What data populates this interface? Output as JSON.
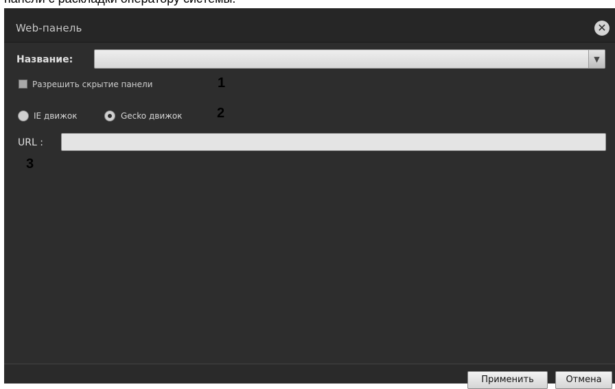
{
  "page": {
    "caption": "панели с раскладки оператору системы."
  },
  "dialog": {
    "title": "Web-панель",
    "close_icon": "close-icon",
    "name_label": "Название:",
    "name_value": "",
    "hide_panel_label": "Разрешить скрытие панели",
    "hide_panel_checked": false,
    "engines": [
      {
        "label": "IE движок",
        "selected": false
      },
      {
        "label": "Gecko движок",
        "selected": true
      }
    ],
    "url_label": "URL :",
    "url_value": "",
    "apply_button": "Применить",
    "cancel_button": "Отмена"
  },
  "annotations": {
    "marker_1": "1",
    "marker_2": "2",
    "marker_3": "3"
  }
}
